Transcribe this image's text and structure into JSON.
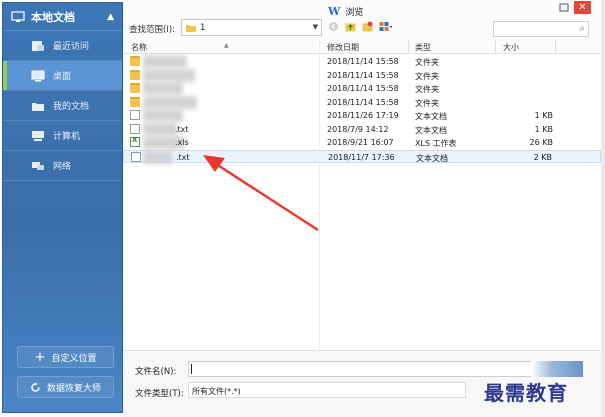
{
  "sidebar": {
    "title": "本地文档",
    "items": [
      {
        "label": "最近访问",
        "icon": "clock-icon"
      },
      {
        "label": "桌面",
        "icon": "monitor-icon",
        "active": true
      },
      {
        "label": "我的文档",
        "icon": "folder-icon"
      },
      {
        "label": "计算机",
        "icon": "computer-icon"
      },
      {
        "label": "网络",
        "icon": "network-icon"
      }
    ],
    "custom_location_label": "自定义位置",
    "recovery_label": "数据恢复大师"
  },
  "window": {
    "app_name": "浏览",
    "app_logo": "W"
  },
  "toolbar": {
    "scope_label": "查找范围(I):",
    "scope_value": "1"
  },
  "columns": {
    "name": "名称",
    "modified": "修改日期",
    "type": "类型",
    "size": "大小"
  },
  "files": [
    {
      "kind": "folder",
      "name": "",
      "modified": "2018/11/14 15:58",
      "type": "文件夹",
      "size": ""
    },
    {
      "kind": "folder",
      "name": "",
      "modified": "2018/11/14 15:58",
      "type": "文件夹",
      "size": ""
    },
    {
      "kind": "folder",
      "name": "",
      "modified": "2018/11/14 15:58",
      "type": "文件夹",
      "size": ""
    },
    {
      "kind": "folder",
      "name": "",
      "modified": "2018/11/14 15:58",
      "type": "文件夹",
      "size": ""
    },
    {
      "kind": "txt",
      "name": "",
      "modified": "2018/11/26 17:19",
      "type": "文本文档",
      "size": "1 KB"
    },
    {
      "kind": "txt",
      "name": ".txt",
      "modified": "2018/7/9 14:12",
      "type": "文本文档",
      "size": "1 KB"
    },
    {
      "kind": "xls",
      "name": ".xls",
      "modified": "2018/9/21 16:07",
      "type": "XLS 工作表",
      "size": "26 KB"
    },
    {
      "kind": "txt",
      "name": ".txt",
      "modified": "2018/11/7 17:36",
      "type": "文本文档",
      "size": "2 KB",
      "selected": true
    }
  ],
  "bottom": {
    "filename_label": "文件名(N):",
    "filename_value": "",
    "filetype_label": "文件类型(T):",
    "filetype_value": "所有文件(*.*)"
  },
  "watermark": "最需教育",
  "colors": {
    "sidebar_bg": "#3d76b5",
    "active_accent": "#8fd14f",
    "close_button": "#e04a3a",
    "arrow": "#e8382c"
  }
}
